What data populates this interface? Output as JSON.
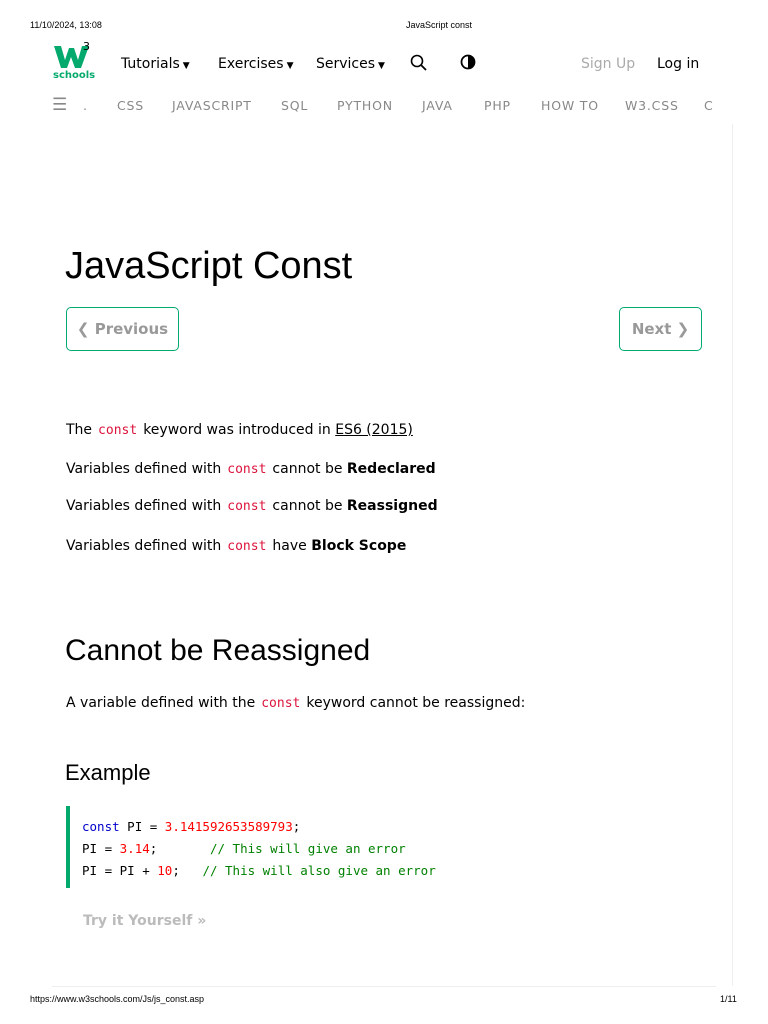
{
  "print_header": {
    "datetime": "11/10/2024, 13:08",
    "title": "JavaScript const"
  },
  "logo": {
    "text": "schools",
    "sup": "3"
  },
  "nav": {
    "tutorials": "Tutorials",
    "exercises": "Exercises",
    "services": "Services",
    "signup": "Sign Up",
    "login": "Log in"
  },
  "subnav": [
    ".",
    "CSS",
    "JAVASCRIPT",
    "SQL",
    "PYTHON",
    "JAVA",
    "PHP",
    "HOW TO",
    "W3.CSS",
    "C"
  ],
  "page_title": "JavaScript Const",
  "prev": "❮ Previous",
  "next": "Next ❯",
  "intro": {
    "l1a": "The",
    "kw": "const",
    "l1b": "keyword was introduced in",
    "l1link": "ES6 (2015)",
    "vdw": "Variables defined with",
    "cannot_be": "cannot be",
    "have": "have",
    "redeclared": "Redeclared",
    "reassigned": "Reassigned",
    "block": "Block Scope"
  },
  "section": {
    "title": "Cannot be Reassigned",
    "text_a": "A variable defined with the",
    "text_b": "keyword cannot be reassigned:"
  },
  "example": {
    "title": "Example",
    "l1": {
      "kw": "const",
      "a": " PI = ",
      "num": "3.141592653589793",
      "b": ";"
    },
    "l2": {
      "a": "PI = ",
      "num": "3.14",
      "b": ";       ",
      "cm": "// This will give an error"
    },
    "l3": {
      "a": "PI = PI + ",
      "num": "10",
      "b": ";   ",
      "cm": "// This will also give an error"
    },
    "try": "Try it Yourself »"
  },
  "print_footer": {
    "url": "https://www.w3schools.com/Js/js_const.asp",
    "page": "1/11"
  },
  "colors": {
    "brand": "#04AA6D"
  }
}
